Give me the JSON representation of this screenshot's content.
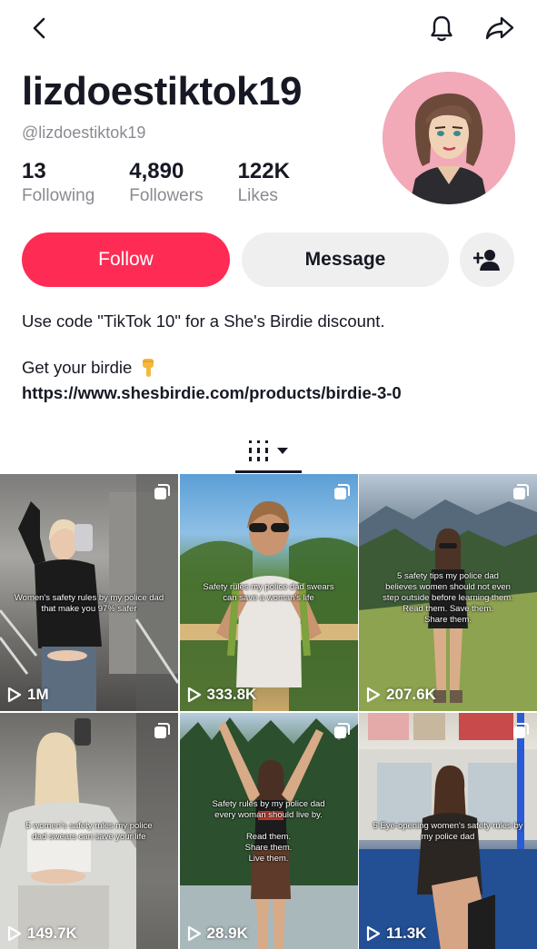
{
  "header": {
    "back_icon": "chevron-left-icon",
    "bell_icon": "bell-icon",
    "share_icon": "share-arrow-icon"
  },
  "profile": {
    "display_name": "lizdoestiktok19",
    "handle": "@lizdoestiktok19",
    "stats": [
      {
        "value": "13",
        "label": "Following"
      },
      {
        "value": "4,890",
        "label": "Followers"
      },
      {
        "value": "122K",
        "label": "Likes"
      }
    ]
  },
  "actions": {
    "follow_label": "Follow",
    "message_label": "Message",
    "add_friend_icon": "add-user-icon"
  },
  "bio": {
    "line1": "Use code \"TikTok 10\" for a She's Birdie discount.",
    "line2": "Get your birdie",
    "link": "https://www.shesbirdie.com/products/birdie-3-0"
  },
  "colors": {
    "accent": "#fe2c55",
    "text": "#161823",
    "muted": "#8a8b91",
    "button_gray": "#efefef"
  },
  "videos": [
    {
      "caption": "Women's safety rules by my police dad\nthat make you 97% safer",
      "views": "1M"
    },
    {
      "caption": "Safety rules my police dad swears\ncan save a woman's life",
      "views": "333.8K"
    },
    {
      "caption": "5 safety tips my police dad\nbelieves women should not even\nstep outside before learning them.\nRead them. Save them.\nShare them.",
      "views": "207.6K"
    },
    {
      "caption": "5 women's safety rules my police\ndad swears can save your life",
      "views": "149.7K"
    },
    {
      "caption": "Safety rules by my police dad\nevery woman should live by.\n\nRead them.\nShare them.\nLive them.",
      "views": "28.9K"
    },
    {
      "caption": "5 Eye-opening women's safety rules by\nmy police dad",
      "views": "11.3K"
    }
  ]
}
